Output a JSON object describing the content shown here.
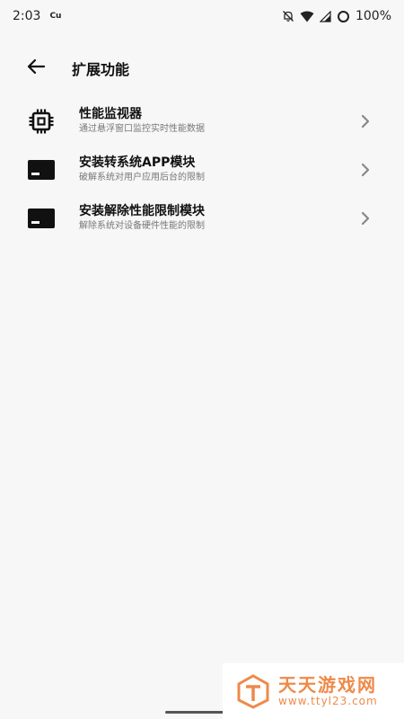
{
  "status_bar": {
    "time": "2:03",
    "carrier": "Cu",
    "battery": "100%",
    "icons": [
      "mute-bell-icon",
      "wifi-icon",
      "signal-icon",
      "battery-ring-icon"
    ]
  },
  "app_bar": {
    "title": "扩展功能",
    "back_icon": "arrow-left-icon"
  },
  "items": [
    {
      "icon": "chip-icon",
      "title": "性能监视器",
      "subtitle": "通过悬浮窗口监控实时性能数据"
    },
    {
      "icon": "window-icon",
      "title": "安装转系统APP模块",
      "subtitle": "破解系统对用户应用后台的限制"
    },
    {
      "icon": "window-icon",
      "title": "安装解除性能限制模块",
      "subtitle": "解除系统对设备硬件性能的限制"
    }
  ],
  "watermark": {
    "name": "天天游戏网",
    "url": "www.ttyl23.com",
    "color": "#ee8a4a"
  }
}
